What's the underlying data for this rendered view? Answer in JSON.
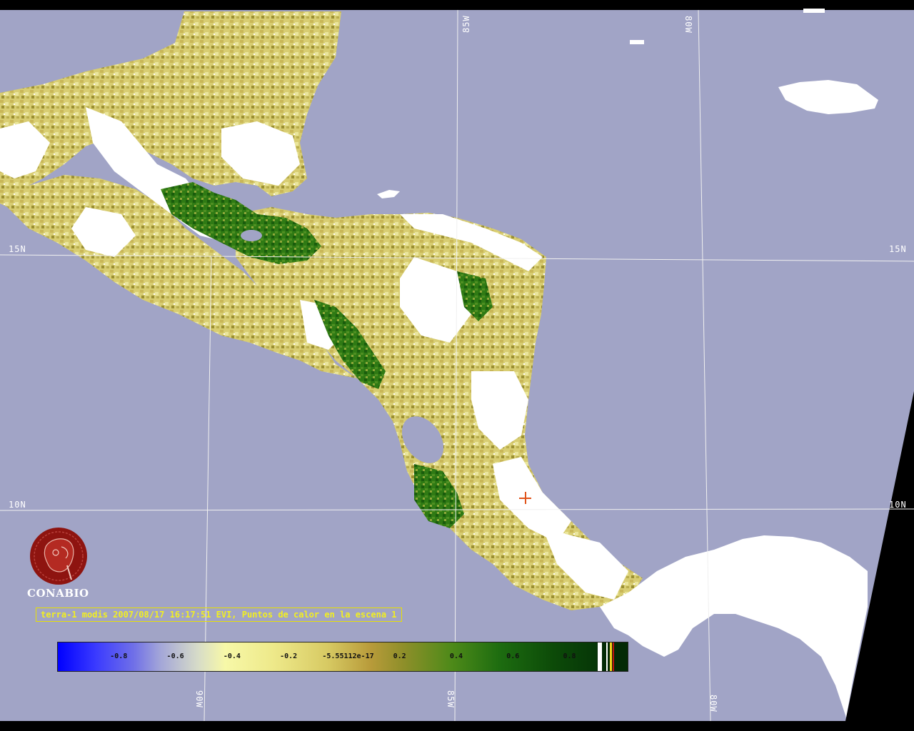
{
  "grid_labels": {
    "lat_15n_left": "15N",
    "lat_15n_right": "15N",
    "lat_10n_left": "10N",
    "lat_10n_right": "10N",
    "lon_85w_top": "85W",
    "lon_80w_top": "80W",
    "lon_90w_bottom": "90W",
    "lon_85w_bottom": "85W",
    "lon_80w_bottom": "80W"
  },
  "logo": {
    "name": "CONABIO",
    "icon": "conabio-macaw-logo-icon"
  },
  "caption": "terra-1 modis 2007/08/17 16:17:51 EVI, Puntos de calor en la escena 1",
  "colorbar": {
    "ticks": [
      "-0.8",
      "-0.6",
      "-0.4",
      "-0.2",
      "-5.55112e-17",
      "0.2",
      "0.4",
      "0.6",
      "0.8"
    ],
    "scale_min": -1.0,
    "scale_max": 1.0
  },
  "colors": {
    "ocean": "#a1a4c6",
    "no_data": "#000000",
    "cloud": "#ffffff",
    "grid": "#f0f0f0",
    "caption_text": "#f2ef20",
    "hotspot_marker": "#e0531a"
  },
  "hotspot_count": 1
}
